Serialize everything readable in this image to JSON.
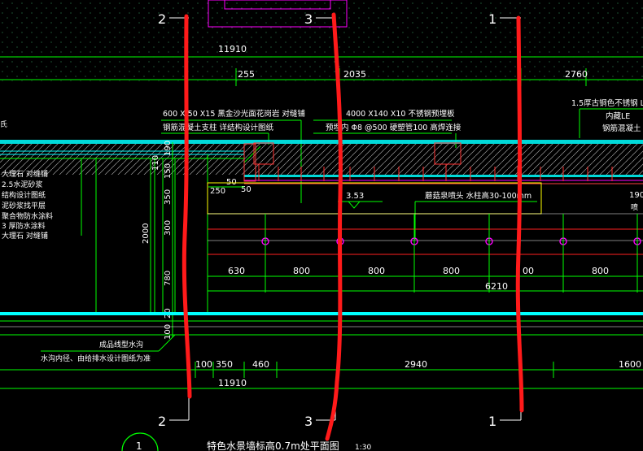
{
  "grid_labels": {
    "top": [
      "2",
      "3",
      "1"
    ],
    "bottom": [
      "2",
      "3",
      "1"
    ]
  },
  "dims_top": {
    "overall": "11910",
    "segments": [
      "255",
      "2035",
      "2760"
    ]
  },
  "dims_mid": {
    "segments": [
      "630",
      "800",
      "800",
      "800",
      "00",
      "800"
    ],
    "sum": "6210"
  },
  "dims_bottom": {
    "segments": [
      "100",
      "350",
      "460",
      "2940",
      "1600"
    ],
    "overall": "11910"
  },
  "dims_vertical": [
    "190",
    "150",
    "350",
    "300",
    "780",
    "20",
    "100",
    "110",
    "2000"
  ],
  "small_dims": [
    "50",
    "250",
    "50"
  ],
  "notes": {
    "stone_top": "600 X 50 X15   黑金沙光面花岗岩   对缝铺",
    "concrete": "钢筋混凝土支柱  详结构设计图纸",
    "steel_plate": "4000 X140 X10  不锈钢预埋板",
    "embedded": "预埋内 Φ8 @500  硬塑管100  高焊连接",
    "stainless": "1.5厚古铜色不锈钢  LO",
    "led": "内藏LE",
    "concrete_r": "钢筋混凝土",
    "level": "3.53",
    "nozzle": "蘑菇泉喷头  水柱高30-100mm",
    "right_190": "190",
    "right_cut": "喷",
    "left_cut": "氏"
  },
  "layer_notes": [
    "大理石  对缝铺",
    "2.5水泥砂浆",
    "结构设计图纸",
    "泥砂浆找平层",
    "聚合物防水涂料",
    "3 厚防水涂料",
    "大理石  对缝铺"
  ],
  "drain_notes": [
    "成品线型水沟",
    "水沟内径、由给排水设计图纸为准"
  ],
  "title": "特色水景墙标高0.7m处平面图",
  "scale": "1:30",
  "detail_no": "1",
  "colors": {
    "cyan": "#00ffff",
    "green": "#00ff00",
    "red": "#ff2020",
    "magenta": "#ff00ff",
    "yellow": "#ffff00",
    "white": "#ffffff",
    "annot": "#ff1a1a"
  }
}
